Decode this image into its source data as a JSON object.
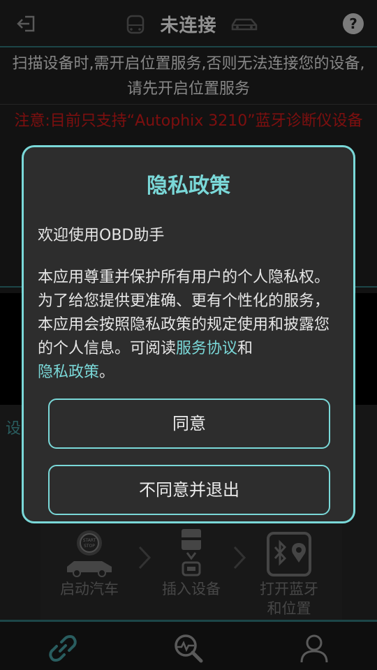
{
  "header": {
    "title": "未连接"
  },
  "info": {
    "text": "扫描设备时,需开启位置服务,否则无法连接您的设备,请先开启位置服务"
  },
  "notice": {
    "text": "注意:目前只支持“Autophix 3210”蓝牙诊断仪设备"
  },
  "side_label": "设",
  "steps": [
    {
      "label": "启动汽车",
      "badge": "START STOP"
    },
    {
      "label": "插入设备"
    },
    {
      "label": "打开蓝牙和位置"
    }
  ],
  "dialog": {
    "title": "隐私政策",
    "welcome": "欢迎使用OBD助手",
    "body_prefix": "本应用尊重并保护所有用户的个人隐私权。为了给您提供更准确、更有个性化的服务，本应用会按照隐私政策的规定使用和披露您的个人信息。可阅读",
    "link_service": "服务协议",
    "conj": "和",
    "link_privacy": "隐私政策",
    "suffix": "。",
    "agree_label": "同意",
    "disagree_label": "不同意并退出"
  },
  "nav": {
    "tabs": [
      {
        "icon": "link-icon",
        "active": true
      },
      {
        "icon": "diagnostic-icon",
        "active": false
      },
      {
        "icon": "user-icon",
        "active": false
      }
    ]
  },
  "colors": {
    "accent": "#7ad8d8",
    "warning": "#c01818",
    "background": "#1c1c1c"
  }
}
